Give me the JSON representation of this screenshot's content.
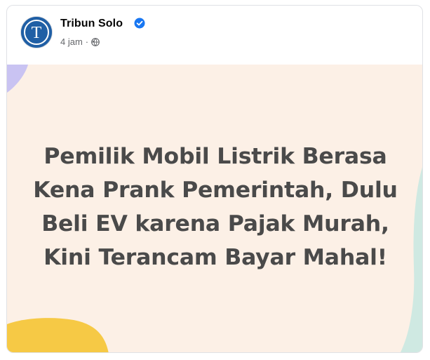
{
  "post": {
    "page_name": "Tribun Solo",
    "timestamp": "4 jam",
    "separator": "·",
    "audience_icon": "globe-icon",
    "verified_icon": "verified-badge-icon",
    "avatar_letter": "T"
  },
  "image": {
    "headline_lines": [
      "Pemilik Mobil Listrik Berasa",
      "Kena Prank Pemerintah, Dulu",
      "Beli EV karena Pajak Murah,",
      "Kini Terancam Bayar Mahal!"
    ],
    "colors": {
      "background": "#fcf0e6",
      "text": "#4a4a4a",
      "accent_purple": "#c9c3f2",
      "accent_yellow": "#f6c945",
      "accent_green": "#cfe9e2"
    }
  },
  "colors": {
    "brand_blue": "#1f5fa5",
    "verified_blue": "#1877f2",
    "meta_gray": "#65676b"
  }
}
